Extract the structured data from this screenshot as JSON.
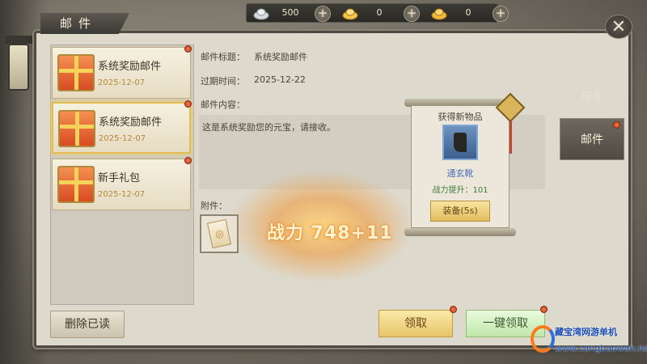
{
  "header": {
    "title": "邮件"
  },
  "currency": [
    {
      "icon": "silver-ingot-icon",
      "value": "500"
    },
    {
      "icon": "gold-ingot-icon",
      "value": "0"
    },
    {
      "icon": "gold-bar-icon",
      "value": "0"
    }
  ],
  "mail_list": [
    {
      "name": "系统奖励邮件",
      "date": "2025-12-07",
      "selected": false
    },
    {
      "name": "系统奖励邮件",
      "date": "2025-12-07",
      "selected": true
    },
    {
      "name": "新手礼包",
      "date": "2025-12-07",
      "selected": false
    }
  ],
  "detail": {
    "subject_label": "邮件标题：",
    "subject": "系统奖励邮件",
    "expire_label": "过期时间：",
    "expire": "2025-12-22",
    "content_label": "邮件内容：",
    "content": "这是系统奖励您的元宝，请接收。",
    "attachment_label": "附件："
  },
  "power_popup": {
    "text": "战力 748+11"
  },
  "buttons": {
    "delete_read": "删除已读",
    "claim": "领取",
    "claim_all": "一键领取"
  },
  "side_tabs": [
    {
      "label": "好友"
    },
    {
      "label": "邮件",
      "active": true
    }
  ],
  "item_popup": {
    "title": "获得新物品",
    "item_name": "通玄靴",
    "power_gain": "战力提升：101",
    "equip_button": "装备(5s)"
  },
  "watermark": {
    "line1": "藏宝湾网游单机",
    "line2": "www.cangbaowan.net"
  }
}
